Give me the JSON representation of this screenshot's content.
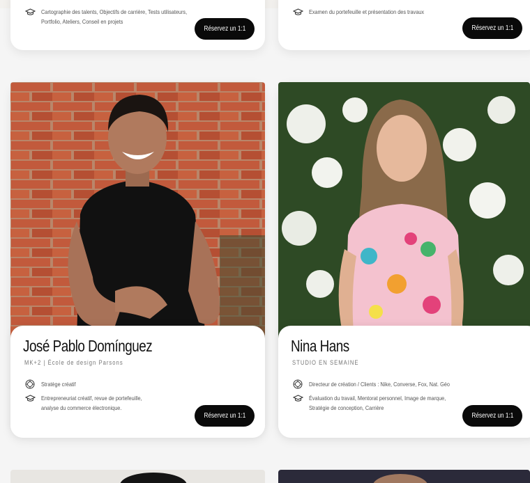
{
  "cards_top": [
    {
      "service_line": "Cartographie des talents, Objectifs de carrière, Tests utilisateurs,\nPortfolio, Ateliers, Conseil en projets",
      "book_label": "Réservez un 1:1"
    },
    {
      "service_line": "Examen du portefeuille et présentation des travaux",
      "book_label": "Réservez un 1:1"
    }
  ],
  "mentors": [
    {
      "name": "José Pablo Domínguez",
      "subtitle": "MK+2 | École de design Parsons",
      "expertise": "Stratège créatif",
      "services": "Entrepreneuriat créatif, revue de portefeuille,\nanalyse du commerce électronique.",
      "book_label": "Réservez un 1:1"
    },
    {
      "name": "Nina Hans",
      "subtitle": "STUDIO EN SEMAINE",
      "expertise": "Directeur de création / Clients : Nike, Converse, Fox, Nat. Géo",
      "services": "Évaluation du travail, Mentorat personnel, Image de marque,\nStratégie de conception, Carrière",
      "book_label": "Réservez un 1:1"
    }
  ],
  "icons": {
    "expertise": "badge-icon",
    "services": "graduation-cap-icon"
  },
  "colors": {
    "button_bg": "#0a0a0a",
    "button_text": "#ffffff",
    "card_bg": "#ffffff",
    "page_bg": "#f5f5f5"
  }
}
